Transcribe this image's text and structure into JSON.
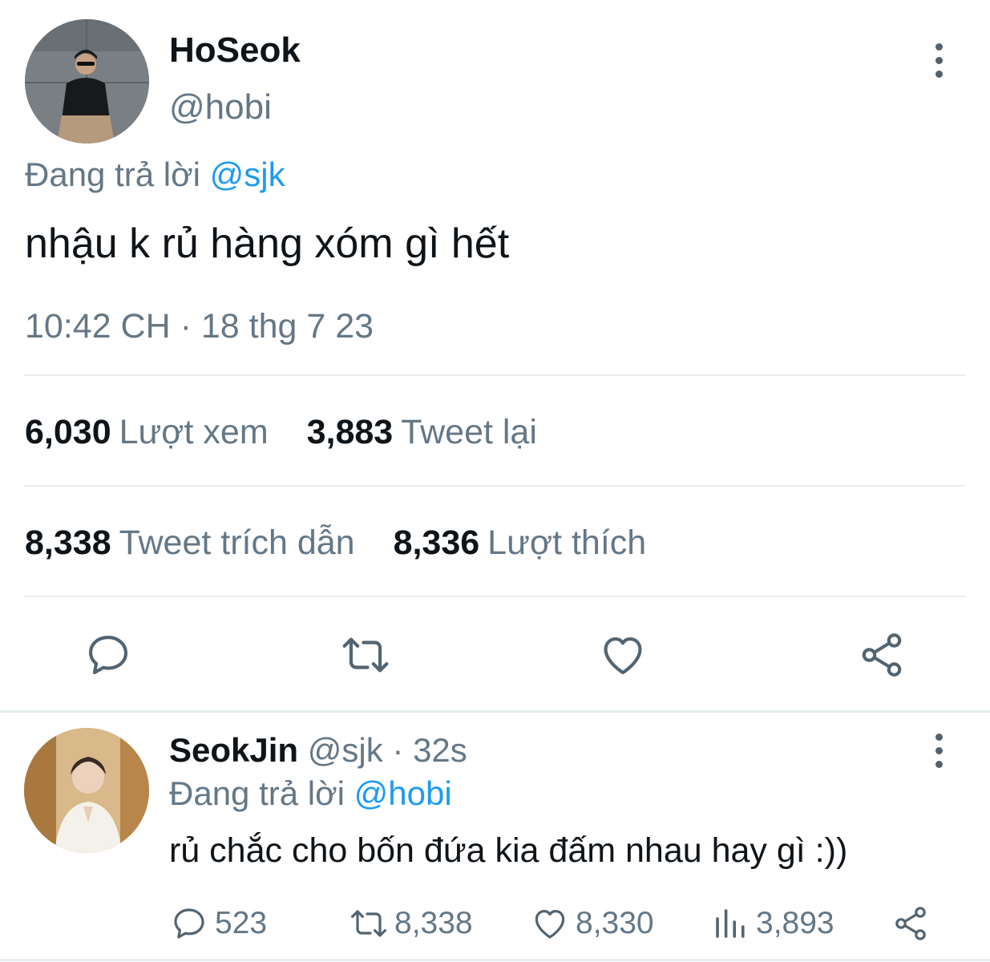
{
  "main_tweet": {
    "display_name": "HoSeok",
    "handle": "@hobi",
    "reply_prefix": "Đang trả lời",
    "reply_mention": "@sjk",
    "text": "nhậu k rủ hàng xóm gì hết",
    "timestamp": "10:42 CH · 18 thg 7 23",
    "stats": {
      "views": {
        "count": "6,030",
        "label": "Lượt xem"
      },
      "retweets": {
        "count": "3,883",
        "label": "Tweet lại"
      },
      "quotes": {
        "count": "8,338",
        "label": "Tweet trích dẫn"
      },
      "likes": {
        "count": "8,336",
        "label": "Lượt thích"
      }
    },
    "actions": [
      "reply-icon",
      "retweet-icon",
      "heart-icon",
      "share-icon"
    ]
  },
  "reply_tweet": {
    "display_name": "SeokJin",
    "handle": "@sjk",
    "separator": "·",
    "time": "32s",
    "reply_prefix": "Đang trả lời",
    "reply_mention": "@hobi",
    "text": "rủ chắc cho bốn đứa kia đấm nhau hay gì :))",
    "counts": {
      "replies": "523",
      "retweets": "8,338",
      "likes": "8,330",
      "views": "3,893"
    }
  },
  "colors": {
    "text_primary": "#0f1419",
    "text_secondary": "#657786",
    "accent": "#1d9bf0",
    "divider": "#e6ecf0"
  }
}
